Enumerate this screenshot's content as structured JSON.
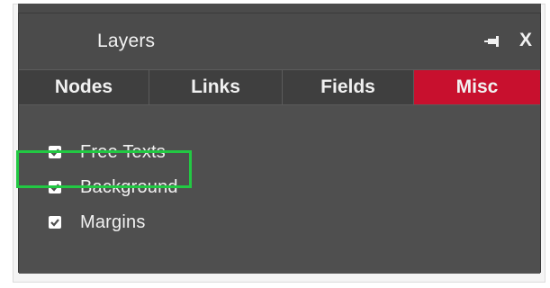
{
  "panel": {
    "title": "Layers",
    "close_label": "X"
  },
  "tabs": [
    {
      "label": "Nodes",
      "active": false
    },
    {
      "label": "Links",
      "active": false
    },
    {
      "label": "Fields",
      "active": false
    },
    {
      "label": "Misc",
      "active": true
    }
  ],
  "misc": {
    "items": [
      {
        "label": "Free Texts",
        "checked": true
      },
      {
        "label": "Background",
        "checked": true,
        "highlighted": true
      },
      {
        "label": "Margins",
        "checked": true
      }
    ]
  },
  "colors": {
    "active_tab": "#c8102e",
    "highlight": "#22c943",
    "panel_bg": "#4f4f4f"
  },
  "icons": [
    "pin-icon",
    "close-icon",
    "checkbox-checked-icon"
  ]
}
